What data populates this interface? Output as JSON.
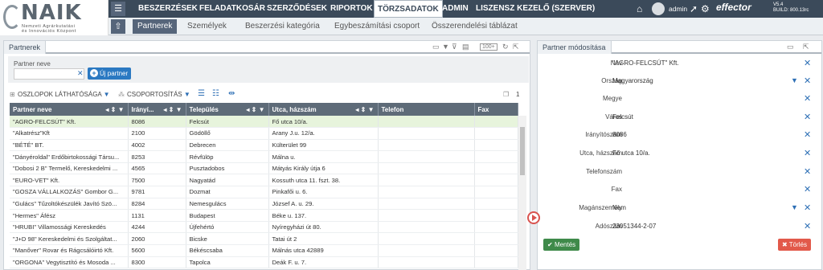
{
  "logo": {
    "name": "NAIK",
    "line1": "Nemzeti Agrárkutatási",
    "line2": "és Innovációs Központ"
  },
  "nav": {
    "items": [
      "BESZERZÉSEK",
      "FELADATKOSÁR",
      "SZERZŐDÉSEK",
      "RIPORTOK",
      "TÖRZSADATOK",
      "ADMIN",
      "LISZENSZ KEZELŐ (SZERVER)"
    ],
    "active": "TÖRZSADATOK"
  },
  "subnav": {
    "items": [
      "Partnerek",
      "Személyek",
      "Beszerzési kategória",
      "Egybeszámítási csoport",
      "Összerendelési táblázat"
    ],
    "active": "Partnerek"
  },
  "user": {
    "name": "admin",
    "brand": "effector",
    "version": "V5.4",
    "build": "BUILD: 800.13rc"
  },
  "left": {
    "title": "Partnerek",
    "paging": "100+",
    "filter_label": "Partner neve",
    "filter_value": "",
    "new_button": "Új partner",
    "toolbar": {
      "columns": "OSZLOPOK LÁTHATÓSÁGA",
      "grouping": "CSOPORTOSÍTÁS",
      "count": "1"
    },
    "columns": [
      "Partner neve",
      "Irányí...",
      "Település",
      "Utca, házszám",
      "Telefon",
      "Fax"
    ],
    "rows": [
      [
        "\"AGRO-FELCSÚT\" Kft.",
        "8086",
        "Felcsút",
        "Fő utca 10/a.",
        "",
        ""
      ],
      [
        "\"Alkatrész\"Kft",
        "2100",
        "Gödöllő",
        "Arany J.u. 12/a.",
        "",
        ""
      ],
      [
        "\"BÉTÉ\" BT.",
        "4002",
        "Debrecen",
        "Külterület 99",
        "",
        ""
      ],
      [
        "\"Dányéroldal\" Erdőbirtokossági Társu...",
        "8253",
        "Révfülöp",
        "Málna u.",
        "",
        ""
      ],
      [
        "\"Dobosi 2 B\" Termelő, Kereskedelmi ...",
        "4565",
        "Pusztadobos",
        "Mátyás Király útja 6",
        "",
        ""
      ],
      [
        "\"EURO-VET\" Kft.",
        "7500",
        "Nagyatád",
        "Kossuth utca 11. fszt. 38.",
        "",
        ""
      ],
      [
        "\"GOSZA VÁLLALKOZÁS\" Gombor G...",
        "9781",
        "Dozmat",
        "Pinkafői u. 6.",
        "",
        ""
      ],
      [
        "\"Gulács\" Tűzoltókészülék Javító Szö...",
        "8284",
        "Nemesgulács",
        "József A. u. 29.",
        "",
        ""
      ],
      [
        "\"Hermes\" Áfész",
        "1131",
        "Budapest",
        "Béke u. 137.",
        "",
        ""
      ],
      [
        "\"HRUBI\" Villamossági Kereskedés",
        "4244",
        "Újfehértó",
        "Nyíregyházi út 80.",
        "",
        ""
      ],
      [
        "\"J+D 98\" Kereskedelmi és Szolgáltat...",
        "2060",
        "Bicske",
        "Tatai út 2",
        "",
        ""
      ],
      [
        "\"Manőver\" Rovar és Rágcsálóirtó Kft.",
        "5600",
        "Békéscsaba",
        "Málnás utca 42889",
        "",
        ""
      ],
      [
        "\"ORGONA\" Vegytisztító és Mosoda ...",
        "8300",
        "Tapolca",
        "Deák F. u. 7.",
        "",
        ""
      ]
    ]
  },
  "right": {
    "title": "Partner módosítása",
    "fields": [
      {
        "label": "Név",
        "value": "\"AGRO-FELCSÚT\" Kft.",
        "dropdown": false
      },
      {
        "label": "Ország",
        "value": "Magyarország",
        "dropdown": true
      },
      {
        "label": "Megye",
        "value": "",
        "dropdown": false
      },
      {
        "label": "Város",
        "value": "Felcsút",
        "dropdown": false
      },
      {
        "label": "Irányítószám",
        "value": "8086",
        "dropdown": false
      },
      {
        "label": "Utca, házszám",
        "value": "Fő utca 10/a.",
        "dropdown": false
      },
      {
        "label": "Telefonszám",
        "value": "",
        "dropdown": false
      },
      {
        "label": "Fax",
        "value": "",
        "dropdown": false
      },
      {
        "label": "Magánszemély",
        "value": "Nem",
        "dropdown": true
      },
      {
        "label": "Adószám",
        "value": "23051344-2-07",
        "dropdown": false
      }
    ],
    "save": "Mentés",
    "delete": "Törlés"
  },
  "colors": {
    "topbar": "#3b4a5a",
    "header": "#5e6b78",
    "primary": "#2b79c2",
    "save": "#3f8a4a",
    "delete": "#e2594a",
    "selected_row": "#e7f4dc"
  }
}
